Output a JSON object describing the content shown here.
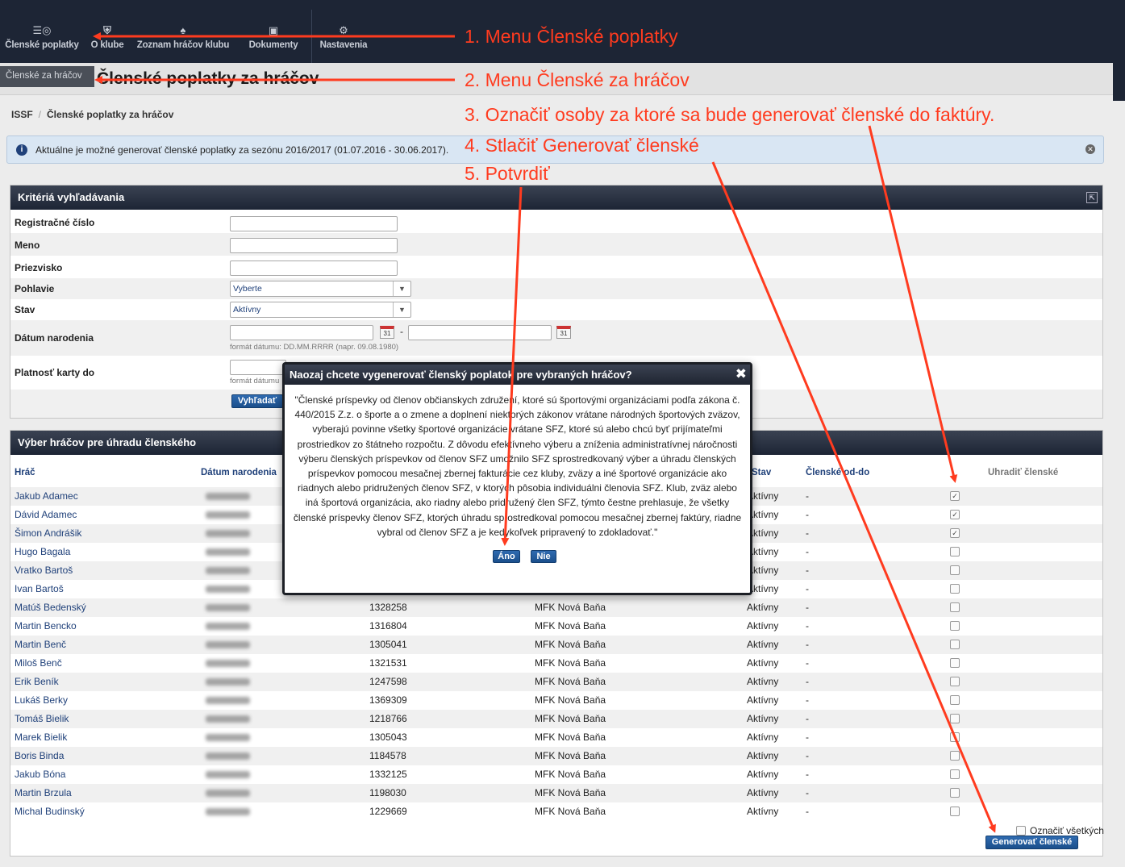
{
  "topmenu": {
    "items": [
      {
        "label": "Členské poplatky",
        "icon": "coins-icon"
      },
      {
        "label": "O klube",
        "icon": "shield-icon"
      },
      {
        "label": "Zoznam hráčov klubu",
        "icon": "jersey-icon"
      },
      {
        "label": "Dokumenty",
        "icon": "folder-icon"
      },
      {
        "label": "Nastavenia",
        "icon": "gears-icon"
      }
    ]
  },
  "submenu": {
    "active_tab": "Členské za hráčov"
  },
  "page": {
    "title": "Členské poplatky za hráčov"
  },
  "breadcrumb": {
    "root": "ISSF",
    "current": "Členské poplatky za hráčov"
  },
  "info": {
    "text": "Aktuálne je možné generovať členské poplatky za sezónu 2016/2017 (01.07.2016 - 30.06.2017)."
  },
  "search": {
    "title": "Kritériá vyhľadávania",
    "fields": {
      "reg_no": "Registračné číslo",
      "name": "Meno",
      "surname": "Priezvisko",
      "gender": "Pohlavie",
      "gender_value": "Vyberte",
      "status": "Stav",
      "status_value": "Aktívny",
      "birth": "Dátum narodenia",
      "birth_dash": "-",
      "date_hint": "formát dátumu: DD.MM.RRRR (napr. 09.08.1980)",
      "card": "Platnosť karty do",
      "card_hint": "formát dátumu"
    },
    "submit_label": "Vyhľadať"
  },
  "players": {
    "title": "Výber hráčov pre úhradu členského",
    "columns": {
      "player": "Hráč",
      "birth": "Dátum narodenia",
      "status": "Stav",
      "fee_range": "Členské od-do",
      "pay": "Uhradiť členské"
    },
    "rows": [
      {
        "name": "Jakub Adamec",
        "reg": "",
        "club": "",
        "status": "Aktívny",
        "fee": "-",
        "checked": true
      },
      {
        "name": "Dávid Adamec",
        "reg": "",
        "club": "",
        "status": "Aktívny",
        "fee": "-",
        "checked": true
      },
      {
        "name": "Šimon Andrášik",
        "reg": "",
        "club": "",
        "status": "Aktívny",
        "fee": "-",
        "checked": true
      },
      {
        "name": "Hugo Bagala",
        "reg": "",
        "club": "",
        "status": "Aktívny",
        "fee": "-",
        "checked": false
      },
      {
        "name": "Vratko Bartoš",
        "reg": "",
        "club": "",
        "status": "Aktívny",
        "fee": "-",
        "checked": false
      },
      {
        "name": "Ivan Bartoš",
        "reg": "",
        "club": "",
        "status": "Aktívny",
        "fee": "-",
        "checked": false
      },
      {
        "name": "Matúš Bedenský",
        "reg": "1328258",
        "club": "MFK Nová Baňa",
        "status": "Aktívny",
        "fee": "-",
        "checked": false
      },
      {
        "name": "Martin Bencko",
        "reg": "1316804",
        "club": "MFK Nová Baňa",
        "status": "Aktívny",
        "fee": "-",
        "checked": false
      },
      {
        "name": "Martin Benč",
        "reg": "1305041",
        "club": "MFK Nová Baňa",
        "status": "Aktívny",
        "fee": "-",
        "checked": false
      },
      {
        "name": "Miloš Benč",
        "reg": "1321531",
        "club": "MFK Nová Baňa",
        "status": "Aktívny",
        "fee": "-",
        "checked": false
      },
      {
        "name": "Erik Beník",
        "reg": "1247598",
        "club": "MFK Nová Baňa",
        "status": "Aktívny",
        "fee": "-",
        "checked": false
      },
      {
        "name": "Lukáš Berky",
        "reg": "1369309",
        "club": "MFK Nová Baňa",
        "status": "Aktívny",
        "fee": "-",
        "checked": false
      },
      {
        "name": "Tomáš Bielik",
        "reg": "1218766",
        "club": "MFK Nová Baňa",
        "status": "Aktívny",
        "fee": "-",
        "checked": false
      },
      {
        "name": "Marek Bielik",
        "reg": "1305043",
        "club": "MFK Nová Baňa",
        "status": "Aktívny",
        "fee": "-",
        "checked": false
      },
      {
        "name": "Boris Binda",
        "reg": "1184578",
        "club": "MFK Nová Baňa",
        "status": "Aktívny",
        "fee": "-",
        "checked": false
      },
      {
        "name": "Jakub Bóna",
        "reg": "1332125",
        "club": "MFK Nová Baňa",
        "status": "Aktívny",
        "fee": "-",
        "checked": false
      },
      {
        "name": "Martin Brzula",
        "reg": "1198030",
        "club": "MFK Nová Baňa",
        "status": "Aktívny",
        "fee": "-",
        "checked": false
      },
      {
        "name": "Michal Budinský",
        "reg": "1229669",
        "club": "MFK Nová Baňa",
        "status": "Aktívny",
        "fee": "-",
        "checked": false
      }
    ],
    "mark_all_label": "Označiť všetkých",
    "generate_label": "Generovať členské"
  },
  "dialog": {
    "title": "Naozaj chcete vygenerovať členský poplatok pre vybraných hráčov?",
    "body": "\"Členské príspevky od členov občianskych združení, ktoré sú športovými organizáciami podľa zákona č. 440/2015 Z.z. o športe a o zmene a doplnení niektorých zákonov vrátane národných športových zväzov, vyberajú povinne všetky športové organizácie vrátane SFZ, ktoré sú alebo chcú byť prijímateľmi prostriedkov zo štátneho rozpočtu. Z dôvodu efektívneho výberu a zníženia administratívnej náročnosti výberu členských príspevkov od členov SFZ umožnilo SFZ sprostredkovaný výber a úhradu členských príspevkov pomocou mesačnej zbernej fakturácie cez kluby, zväzy a iné športové organizácie ako riadnych alebo pridružených členov SFZ, v ktorých pôsobia individuálni členovia SFZ. Klub, zväz alebo iná športová organizácia, ako riadny alebo pridružený člen SFZ, týmto čestne prehlasuje, že všetky členské príspevky členov SFZ, ktorých úhradu sprostredkoval pomocou mesačnej zbernej faktúry, riadne vybral od členov SFZ a je kedykoľvek pripravený to zdokladovať.\"",
    "yes_label": "Áno",
    "no_label": "Nie"
  },
  "annotations": [
    "1. Menu Členské poplatky",
    "2. Menu Členské za hráčov",
    "3. Označiť osoby za ktoré sa bude generovať členské do faktúry.",
    "4. Stlačiť Generovať členské",
    "5. Potvrdiť"
  ],
  "colors": {
    "navbar": "#1d2535",
    "link": "#20417a",
    "annotation": "#ff3b1f",
    "button": "#1b4f8c"
  }
}
